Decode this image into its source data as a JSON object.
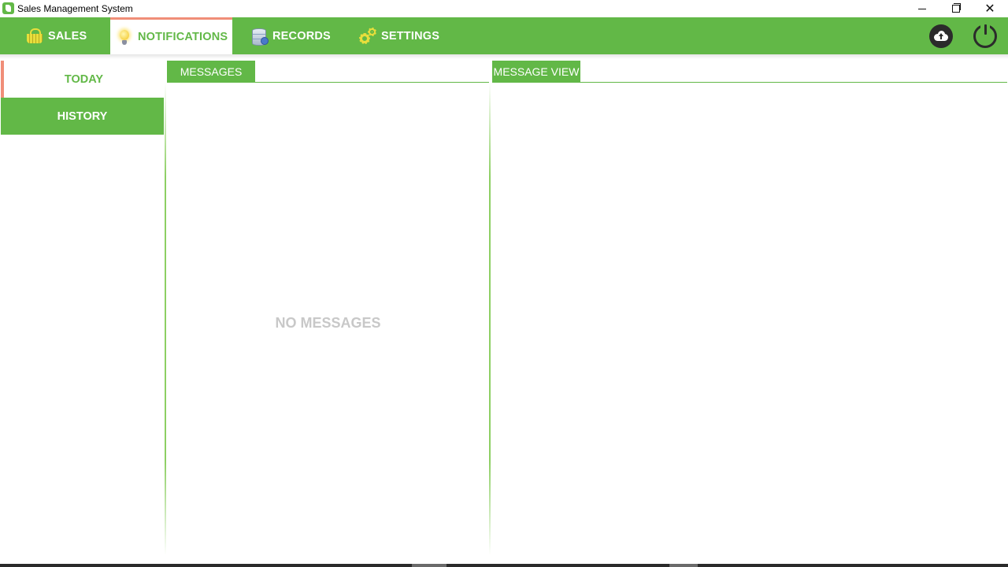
{
  "window": {
    "title": "Sales Management System",
    "minimize_icon": "minimize-icon",
    "maximize_icon": "restore-icon",
    "close_icon": "close-icon",
    "close_glyph": "✕"
  },
  "nav": {
    "items": [
      {
        "label": "SALES",
        "icon": "basket-icon"
      },
      {
        "label": "NOTIFICATIONS",
        "icon": "lightbulb-icon",
        "active": true
      },
      {
        "label": "RECORDS",
        "icon": "database-icon"
      },
      {
        "label": "SETTINGS",
        "icon": "gears-icon"
      }
    ],
    "right_buttons": [
      {
        "icon": "cloud-upload-icon"
      },
      {
        "icon": "power-icon"
      }
    ]
  },
  "sidebar": {
    "items": [
      {
        "label": "TODAY",
        "active": true
      },
      {
        "label": "HISTORY"
      }
    ]
  },
  "messages_panel": {
    "header": "MESSAGES",
    "empty_text": "NO MESSAGES"
  },
  "view_panel": {
    "header": "MESSAGE VIEW"
  },
  "colors": {
    "brand": "#62b847",
    "accent": "#f08e78",
    "empty_text": "#c8c8c8"
  }
}
